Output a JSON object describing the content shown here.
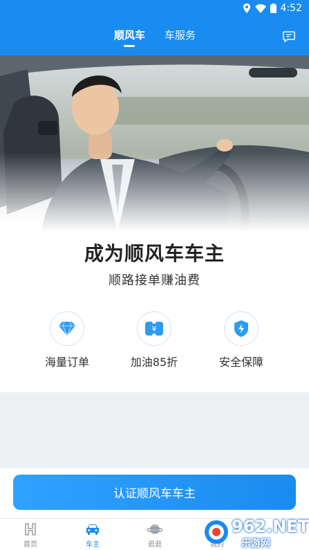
{
  "status_bar": {
    "time": "4:52"
  },
  "header": {
    "tabs": [
      {
        "label": "顺风车",
        "active": true
      },
      {
        "label": "车服务",
        "active": false
      }
    ]
  },
  "promo": {
    "title": "成为顺风车车主",
    "subtitle": "顺路接单赚油费",
    "features": [
      {
        "label": "海量订单",
        "icon": "diamond-icon"
      },
      {
        "label": "加油85折",
        "icon": "yuan-coupon-icon"
      },
      {
        "label": "安全保障",
        "icon": "shield-icon"
      }
    ]
  },
  "cta": {
    "label": "认证顺风车车主"
  },
  "bottom_nav": {
    "items": [
      {
        "label": "首页",
        "icon": "home-logo-icon",
        "active": false
      },
      {
        "label": "车主",
        "icon": "car-icon",
        "active": true
      },
      {
        "label": "逛逛",
        "icon": "planet-icon",
        "active": false
      },
      {
        "label": "我的",
        "icon": "user-icon",
        "active": false
      }
    ]
  },
  "watermark": {
    "text": "962.NET",
    "sub": "乐游网"
  },
  "colors": {
    "brand": "#1a8bf0",
    "accent_light": "#2fa2ff",
    "gray_bg": "#eef1f4"
  }
}
